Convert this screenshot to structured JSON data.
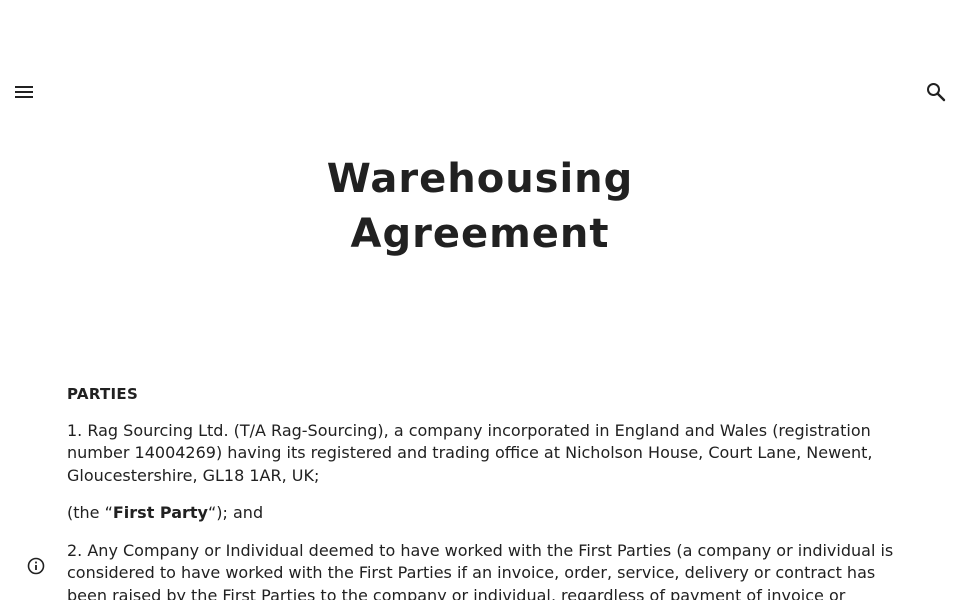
{
  "header": {
    "menu_icon": "hamburger-menu-icon",
    "search_icon": "search-icon"
  },
  "title": {
    "line1": "Warehousing",
    "line2": "Agreement"
  },
  "body": {
    "heading": "PARTIES",
    "para1": "1. Rag Sourcing Ltd. (T/A Rag-Sourcing), a company incorporated in England and Wales (registration number 14004269) having its registered and trading office at Nicholson House, Court Lane, Newent, Gloucestershire, GL18 1AR, UK;",
    "para2_prefix": "(the “",
    "para2_bold": "First Party",
    "para2_suffix": "“); and",
    "para3": "2. Any Company or Individual deemed to have worked with the First Parties (a company or individual is considered to have worked with the First Parties if an invoice, order, service, delivery or contract has been raised by the First Parties to the company or individual, regardless of payment of invoice or"
  },
  "footer": {
    "info_icon": "info-icon"
  }
}
